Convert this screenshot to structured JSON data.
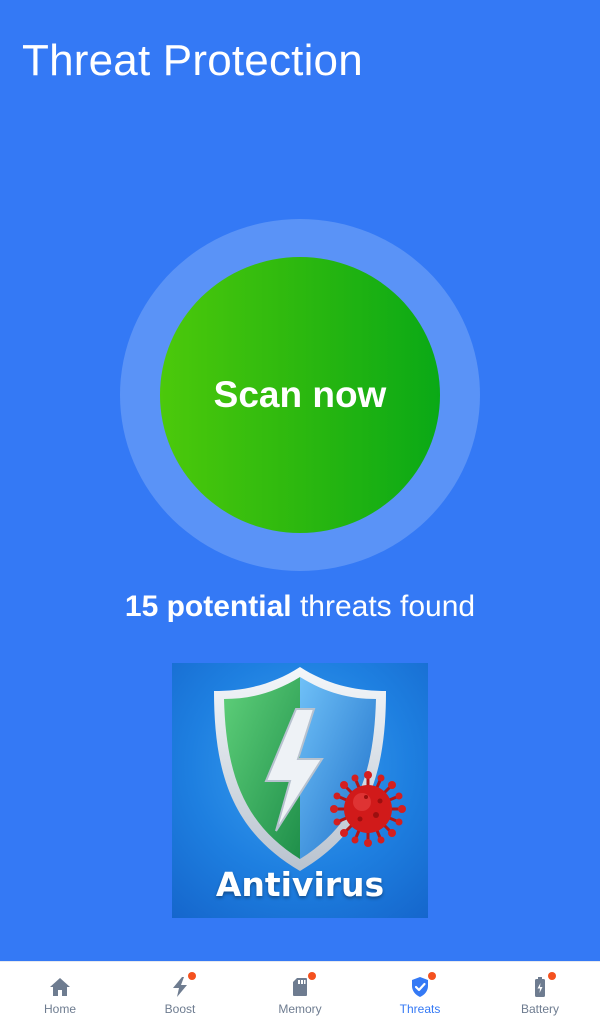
{
  "header": {
    "title": "Threat Protection"
  },
  "scan": {
    "button_label": "Scan now"
  },
  "summary": {
    "count_text": "15 potential",
    "rest_text": " threats found"
  },
  "promo": {
    "label": "Antivirus",
    "icon": "shield-lightning-virus-icon"
  },
  "colors": {
    "background": "#3479f5",
    "scan_green": "#2cb80f",
    "nav_active": "#3479f5",
    "nav_inactive": "#6e7c90",
    "badge": "#f4511e"
  },
  "nav": {
    "items": [
      {
        "label": "Home",
        "icon": "home-icon",
        "badge": false,
        "active": false
      },
      {
        "label": "Boost",
        "icon": "bolt-icon",
        "badge": true,
        "active": false
      },
      {
        "label": "Memory",
        "icon": "sd-card-icon",
        "badge": true,
        "active": false
      },
      {
        "label": "Threats",
        "icon": "shield-check-icon",
        "badge": true,
        "active": true
      },
      {
        "label": "Battery",
        "icon": "battery-icon",
        "badge": true,
        "active": false
      }
    ]
  }
}
